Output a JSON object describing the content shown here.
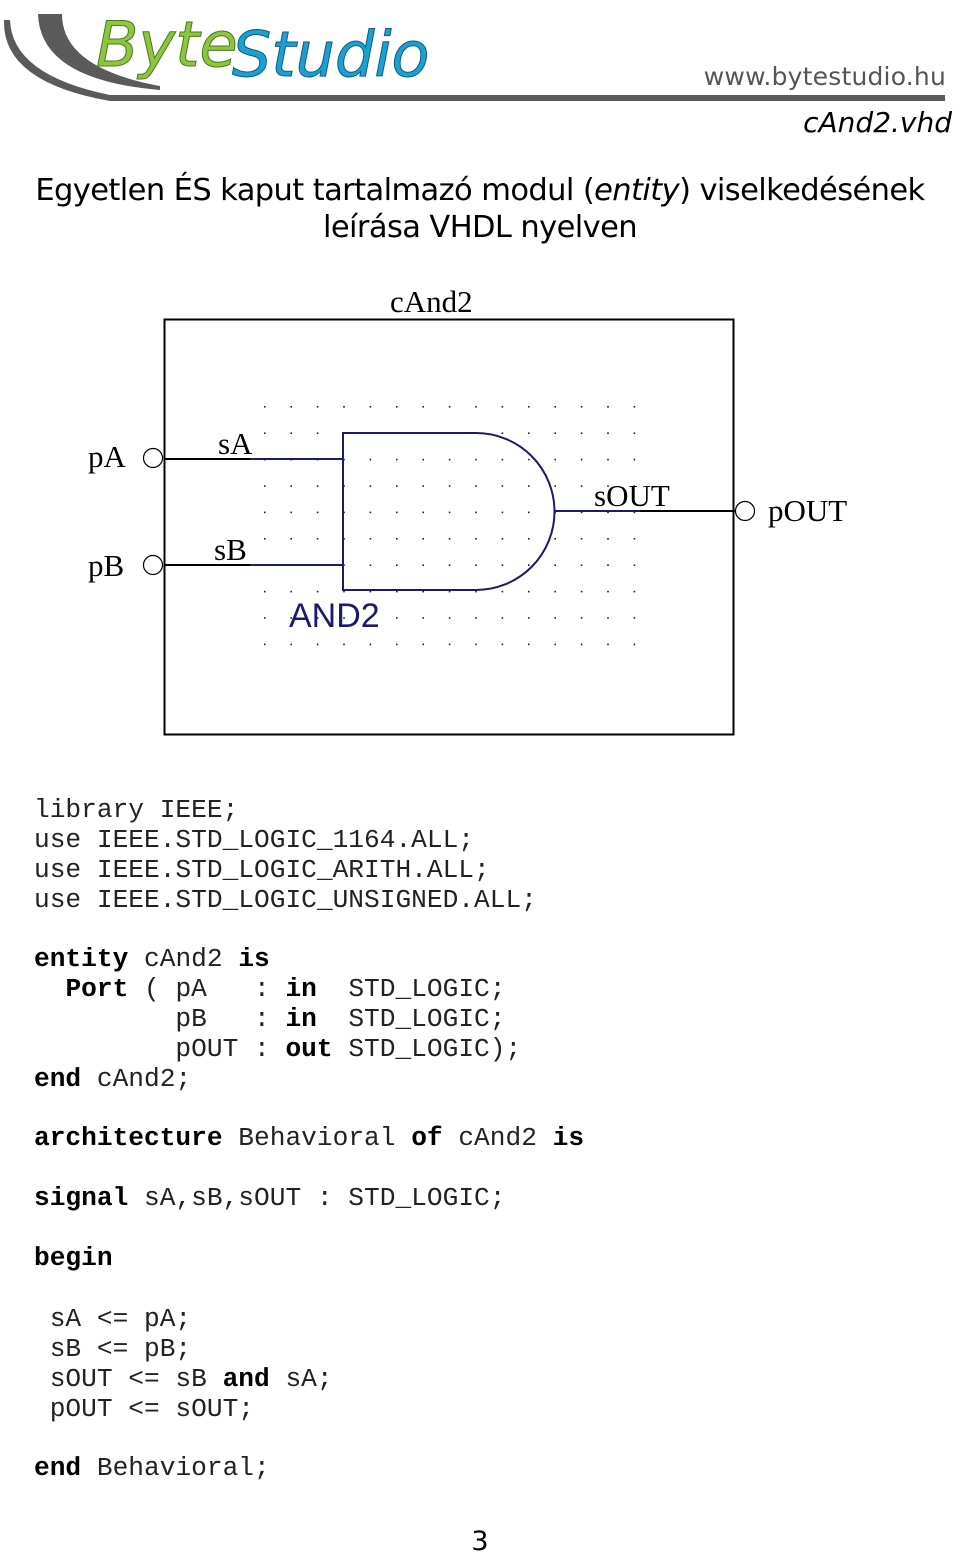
{
  "header": {
    "logo": {
      "part1": "Byte",
      "part2": "Studio",
      "part1_color": "#8cc63f",
      "part2_color": "#1e9fd1",
      "swoosh_color": "#5a5a5a"
    },
    "site_url": "www.bytestudio.hu",
    "file_name": "cAnd2.vhd"
  },
  "title": {
    "line1_before": "Egyetlen ÉS kaput tartalmazó modul (",
    "line1_italic": "entity",
    "line1_after": ") viselkedésének",
    "line2": "leírása VHDL nyelven"
  },
  "diagram": {
    "entity_name": "cAnd2",
    "gate_label": "AND2",
    "gate_color": "#1a1a6e",
    "ports": {
      "input_a": "pA",
      "input_b": "pB",
      "output": "pOUT"
    },
    "signals": {
      "a": "sA",
      "b": "sB",
      "out": "sOUT"
    }
  },
  "code": {
    "library_lines": [
      "library IEEE;",
      "use IEEE.STD_LOGIC_1164.ALL;",
      "use IEEE.STD_LOGIC_ARITH.ALL;",
      "use IEEE.STD_LOGIC_UNSIGNED.ALL;"
    ],
    "entity_block": [
      [
        {
          "t": "entity",
          "b": true
        },
        {
          "t": " cAnd2 "
        },
        {
          "t": "is",
          "b": true
        }
      ],
      [
        {
          "t": "  "
        },
        {
          "t": "Port",
          "b": true
        },
        {
          "t": " ( pA   : "
        },
        {
          "t": "in",
          "b": true
        },
        {
          "t": "  STD_LOGIC;"
        }
      ],
      [
        {
          "t": "         pB   : "
        },
        {
          "t": "in",
          "b": true
        },
        {
          "t": "  STD_LOGIC;"
        }
      ],
      [
        {
          "t": "         pOUT : "
        },
        {
          "t": "out",
          "b": true
        },
        {
          "t": " STD_LOGIC);"
        }
      ],
      [
        {
          "t": "end",
          "b": true
        },
        {
          "t": " cAnd2;"
        }
      ]
    ],
    "architecture_line": [
      {
        "t": "architecture",
        "b": true
      },
      {
        "t": " Behavioral "
      },
      {
        "t": "of",
        "b": true
      },
      {
        "t": " cAnd2 "
      },
      {
        "t": "is",
        "b": true
      }
    ],
    "signal_line": [
      {
        "t": "signal",
        "b": true
      },
      {
        "t": " sA,sB,sOUT : STD_LOGIC;"
      }
    ],
    "begin_line": [
      {
        "t": "begin",
        "b": true
      }
    ],
    "body_lines": [
      [
        {
          "t": " sA <= pA;"
        }
      ],
      [
        {
          "t": " sB <= pB;"
        }
      ],
      [
        {
          "t": " sOUT <= sB "
        },
        {
          "t": "and",
          "b": true
        },
        {
          "t": " sA;"
        }
      ],
      [
        {
          "t": " pOUT <= sOUT;"
        }
      ]
    ],
    "end_line": [
      {
        "t": "end",
        "b": true
      },
      {
        "t": " Behavioral;"
      }
    ]
  },
  "footer": {
    "page_number": "3"
  }
}
